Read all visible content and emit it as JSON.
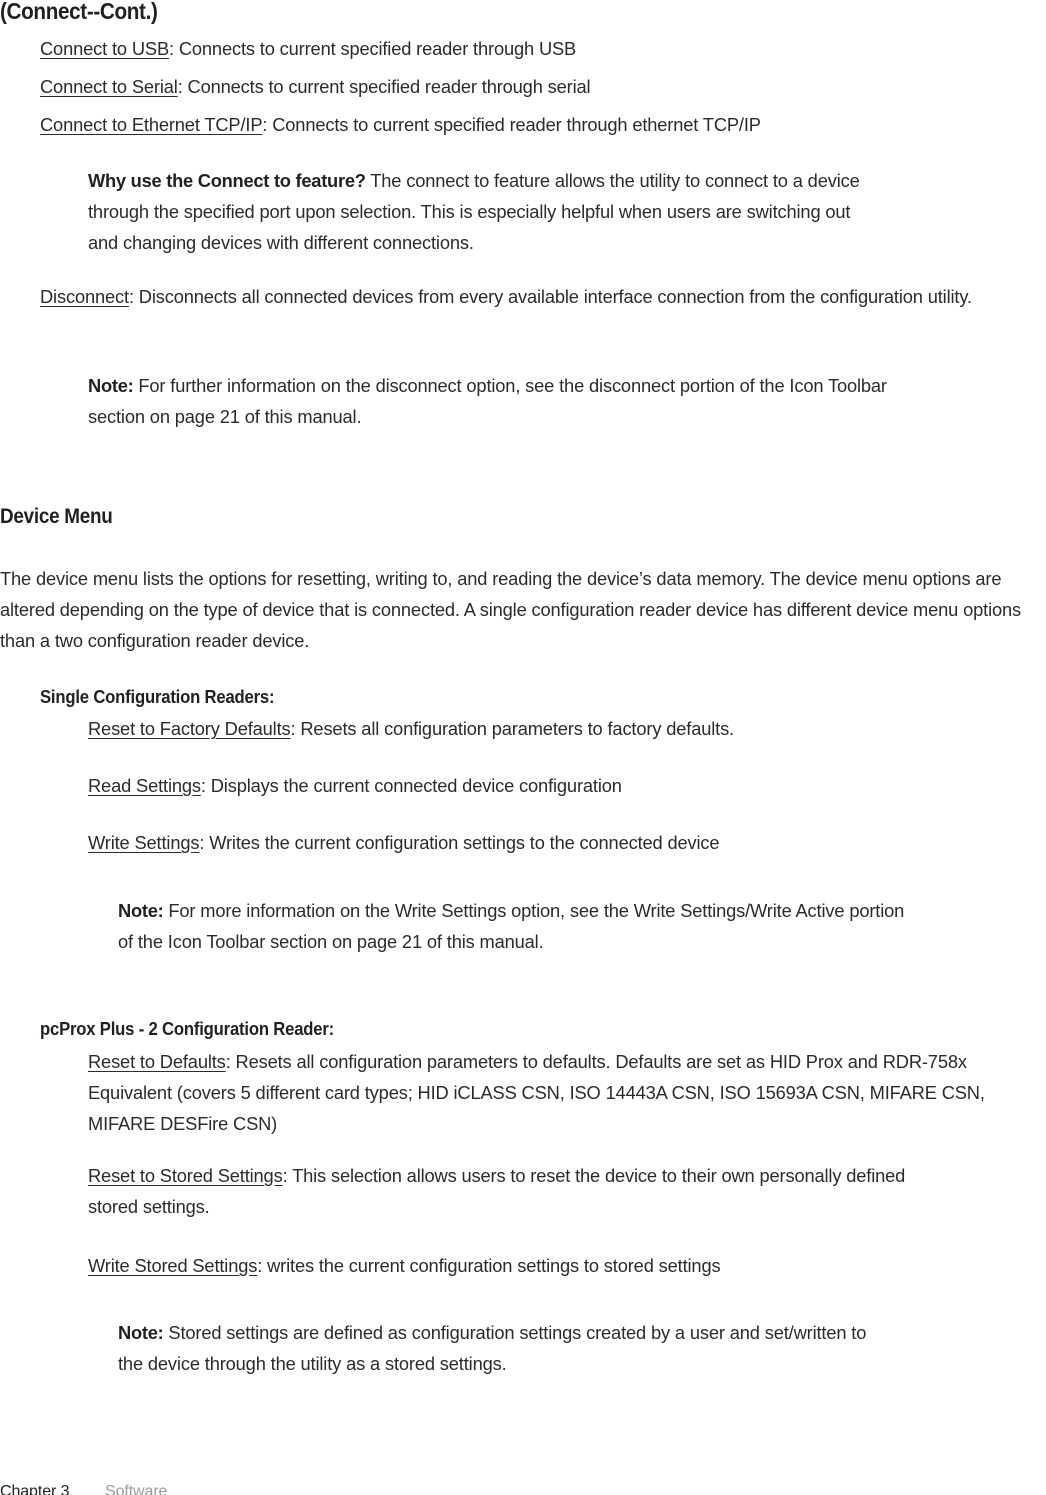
{
  "document": {
    "title": "(Connect--Cont.)"
  },
  "connect_items": [
    {
      "term": "Connect to USB",
      "description": ": Connects to current specified reader through USB"
    },
    {
      "term": "Connect to Serial",
      "description": ": Connects to current specified reader through serial"
    },
    {
      "term": "Connect to Ethernet TCP/IP",
      "description": ": Connects to current specified reader through ethernet TCP/IP"
    }
  ],
  "why_note": {
    "label": "Why use the Connect to feature?",
    "text": " The connect to feature allows the utility to connect to a device through the specified port upon selection. This is especially helpful when users are switching out and changing devices with different connections."
  },
  "disconnect": {
    "term": "Disconnect",
    "description": ": Disconnects all connected devices from every available interface connection from the configuration utility."
  },
  "disconnect_note": {
    "label": "Note:",
    "text": " For further information on the disconnect option, see the disconnect portion of the Icon Toolbar section on page 21 of this manual."
  },
  "device_menu": {
    "heading": "Device Menu",
    "intro": "The device menu lists the options for resetting, writing to, and reading the device’s data memory. The device menu options are altered depending on the type of device that is connected.  A single configuration reader device has different device menu options than a two configuration reader device."
  },
  "single_config": {
    "heading": "Single Configuration Readers:",
    "items": [
      {
        "term": "Reset to Factory Defaults",
        "description": ": Resets all configuration parameters to factory defaults."
      },
      {
        "term": "Read Settings",
        "description": ": Displays the current connected device configuration"
      },
      {
        "term": "Write Settings",
        "description": ": Writes the current configuration settings to the connected device"
      }
    ],
    "note": {
      "label": "Note:",
      "text": " For more information on the Write Settings option, see the Write Settings/Write Active portion of the Icon Toolbar section on page 21 of this manual."
    }
  },
  "two_config": {
    "heading": "pcProx Plus - 2 Configuration Reader:",
    "items": [
      {
        "term": "Reset to Defaults",
        "description": ": Resets all configuration parameters to defaults. Defaults are set as HID Prox and RDR-758x Equivalent (covers 5 different card types; HID iCLASS CSN, ISO 14443A CSN, ISO 15693A CSN, MIFARE CSN, MIFARE DESFire CSN)"
      },
      {
        "term": "Reset to Stored Settings",
        "description": ": This selection allows users to reset the device to their own personally defined stored settings."
      },
      {
        "term": "Write Stored Settings",
        "description": ": writes the current configuration settings to stored settings"
      }
    ],
    "note": {
      "label": "Note:",
      "text": " Stored settings are defined as configuration settings created by a user and set/written to the device through the utility as a stored settings."
    }
  },
  "footer": {
    "chapter": "Chapter 3",
    "section": "Software"
  },
  "colors": {
    "text": "#2d2a2b",
    "heading": "#231f20",
    "footer_muted": "#9b9b9b",
    "background": "#ffffff"
  }
}
